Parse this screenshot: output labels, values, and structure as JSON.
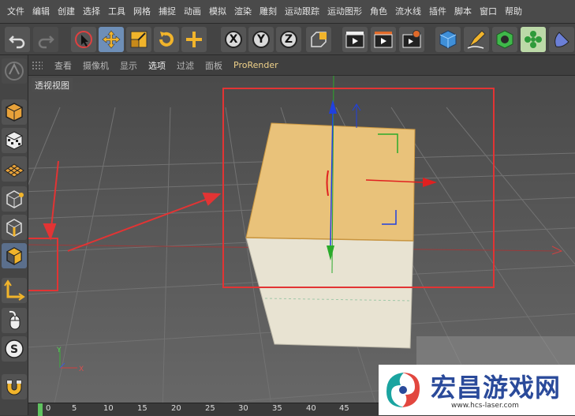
{
  "menu": [
    "文件",
    "编辑",
    "创建",
    "选择",
    "工具",
    "网格",
    "捕捉",
    "动画",
    "模拟",
    "渲染",
    "雕刻",
    "运动跟踪",
    "运动图形",
    "角色",
    "流水线",
    "插件",
    "脚本",
    "窗口",
    "帮助"
  ],
  "toolbar": {
    "undo_icon": "undo-icon",
    "redo_icon": "redo-icon",
    "tools": [
      "select-icon",
      "move-icon",
      "scale-icon",
      "rotate-icon",
      "live-selection-icon"
    ],
    "axis_x": "X",
    "axis_y": "Y",
    "axis_z": "Z",
    "coord_icon": "coordinate-system-icon",
    "render_icons": [
      "render-view-icon",
      "render-picture-viewer-icon",
      "render-settings-icon"
    ],
    "object_icons": [
      "cube-icon",
      "pen-icon",
      "subdivision-icon",
      "cloner-icon",
      "deformer-icon"
    ]
  },
  "viewport_menu": [
    "查看",
    "摄像机",
    "显示",
    "选项",
    "过滤",
    "面板",
    "ProRender"
  ],
  "viewport_selected_menu": "选项",
  "viewport_label": "透视视图",
  "left_tools": [
    "make-editable-icon",
    "texture-mode-icon",
    "workplane-icon",
    "points-mode-icon",
    "edges-mode-icon",
    "polygons-mode-icon",
    "axis-icon",
    "tweak-icon",
    "snap-icon",
    "magnet-icon"
  ],
  "timeline_ticks": [
    "0",
    "5",
    "10",
    "15",
    "20",
    "25",
    "30",
    "35",
    "40",
    "45"
  ],
  "axis_labels": {
    "x": "X",
    "y": "Y"
  },
  "watermark": {
    "title": "宏昌游戏网",
    "url": "www.hcs-laser.com"
  },
  "colors": {
    "selected_face": "#e9c27a",
    "cube_side": "#e8e3d2",
    "annotation_red": "#e23434",
    "axis_x": "#e02020",
    "axis_y": "#20c020",
    "axis_z": "#2040e0"
  }
}
